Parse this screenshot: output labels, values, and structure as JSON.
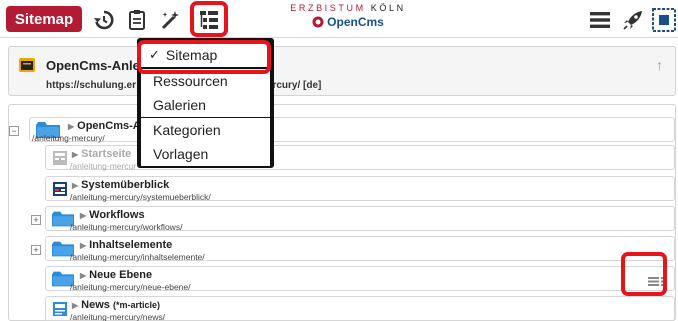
{
  "toolbar": {
    "sitemap_button": "Sitemap",
    "brand_line": "ERZBISTUM",
    "brand_city": "KÖLN",
    "brand_name": "OpenCms",
    "accent_color": "#b31b34",
    "highlight_color": "#e8141b"
  },
  "dropdown": {
    "items": [
      {
        "label": "Sitemap",
        "selected": true
      },
      {
        "label": "Ressourcen"
      },
      {
        "label": "Galerien"
      },
      {
        "label": "Kategorien"
      },
      {
        "label": "Vorlagen"
      }
    ]
  },
  "header": {
    "title": "OpenCms-Anlei",
    "url_start": "https://schulung.er",
    "url_end": "mercury/ [de]"
  },
  "tree": {
    "root": {
      "title": "OpenCms-Anlei",
      "path": "/anleitung-mercury/"
    },
    "items": [
      {
        "title": "Startseite",
        "path": "/anleitung-mercur"
      },
      {
        "title": "Systemüberblick",
        "path": "/anleitung-mercury/systemueberblick/"
      },
      {
        "title": "Workflows",
        "path": "/anleitung-mercury/workflows/"
      },
      {
        "title": "Inhaltselemente",
        "path": "/anleitung-mercury/inhaltselemente/"
      },
      {
        "title": "Neue Ebene",
        "path": "/anleitung-mercury/neue-ebene/"
      },
      {
        "title": "News",
        "suffix": "(*m-article)",
        "path": "/anleitung-mercury/news/"
      }
    ]
  }
}
